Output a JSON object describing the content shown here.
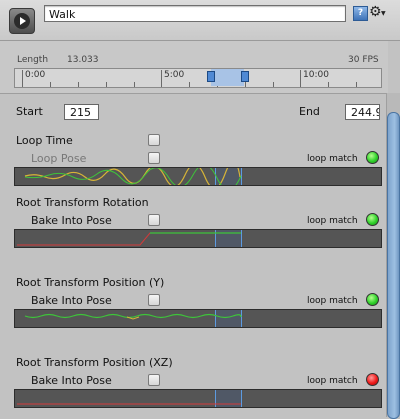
{
  "header": {
    "clip_name": "Walk",
    "play_icon": "play-icon",
    "help_icon": "help-icon",
    "settings_icon": "gear-icon"
  },
  "clip_info": {
    "length_label": "Length",
    "length_value": "13.033",
    "fps": "30 FPS"
  },
  "ruler": {
    "ticks": [
      "0:00",
      "5:00",
      "10:00"
    ]
  },
  "range": {
    "start_label": "Start",
    "start_value": "215",
    "end_label": "End",
    "end_value": "244.9"
  },
  "loop_time": {
    "label": "Loop Time",
    "checked": false,
    "pose_label": "Loop Pose",
    "pose_checked": false,
    "match_label": "loop match",
    "status": "green"
  },
  "root_rotation": {
    "title": "Root Transform Rotation",
    "bake_label": "Bake Into Pose",
    "checked": false,
    "match_label": "loop match",
    "status": "green"
  },
  "root_position_y": {
    "title": "Root Transform Position (Y)",
    "bake_label": "Bake Into Pose",
    "checked": false,
    "match_label": "loop match",
    "status": "green"
  },
  "root_position_xz": {
    "title": "Root Transform Position (XZ)",
    "bake_label": "Bake Into Pose",
    "checked": false,
    "match_label": "loop match",
    "status": "red"
  },
  "colors": {
    "accent": "#4f89d4",
    "status_green": "#2fd12b",
    "status_red": "#f01a1a",
    "curve_yellow": "#d7b437",
    "curve_green": "#3ec43a",
    "curve_red": "#d23a3a"
  }
}
